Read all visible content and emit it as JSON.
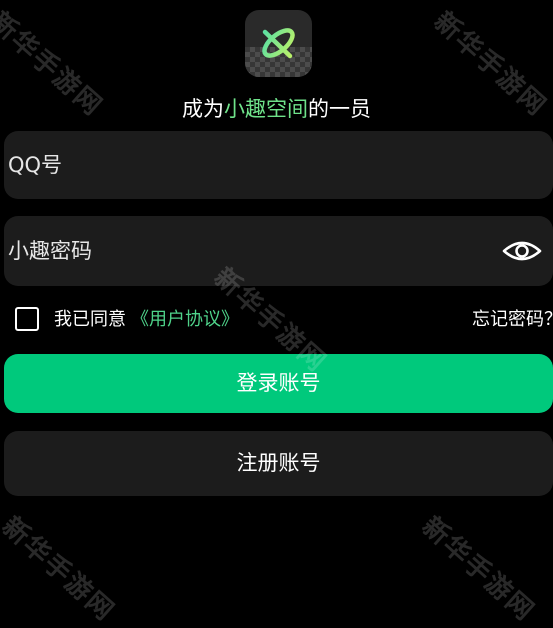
{
  "header": {
    "logo_icon": "orbit-x-logo-icon",
    "tagline_before": "成为",
    "tagline_accent": "小趣空间",
    "tagline_after": "的一员"
  },
  "form": {
    "qq_placeholder": "QQ号",
    "qq_value": "",
    "password_placeholder": "小趣密码",
    "password_value": "",
    "password_toggle_icon": "eye-icon"
  },
  "agreement": {
    "checked": false,
    "label": "我已同意",
    "link_label": "《用户协议》",
    "forgot_label": "忘记密码？"
  },
  "buttons": {
    "login_label": "登录账号",
    "register_label": "注册账号"
  },
  "watermark": {
    "text": "新华手游网"
  },
  "colors": {
    "background": "#000000",
    "field_bg": "#1c1c1c",
    "accent_green": "#00c97c",
    "link_green": "#4fd38a",
    "tagline_accent": "#6fe38a"
  }
}
